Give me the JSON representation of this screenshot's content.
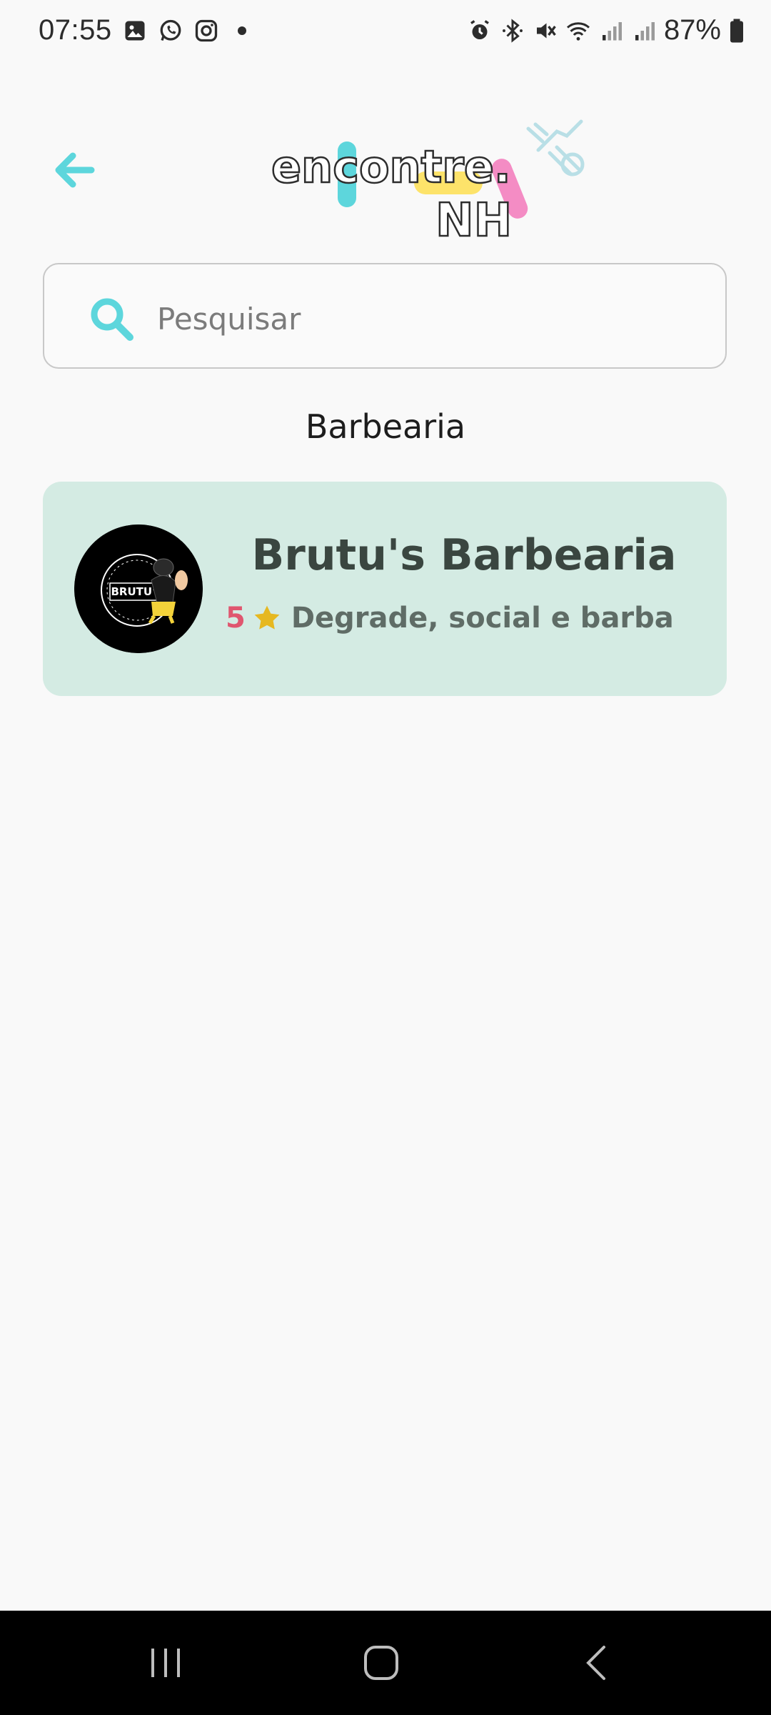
{
  "status_bar": {
    "time": "07:55",
    "battery": "87%",
    "left_icons": [
      "gallery-icon",
      "whatsapp-icon",
      "instagram-icon",
      "dot-icon"
    ],
    "right_icons": [
      "alarm-icon",
      "bluetooth-icon",
      "mute-icon",
      "wifi-icon",
      "signal-icon",
      "signal-icon",
      "battery-icon"
    ]
  },
  "header": {
    "logo_text_top": "encontre.",
    "logo_text_bottom": "NH",
    "logo_colors": {
      "cyan": "#5dd6dc",
      "yellow": "#fde36a",
      "pink": "#f48cc4",
      "outline": "#2d2d2d"
    }
  },
  "search": {
    "placeholder": "Pesquisar",
    "value": ""
  },
  "category": {
    "title": "Barbearia"
  },
  "results": [
    {
      "name": "Brutu's Barbearia",
      "rating": "5",
      "services": "Degrade, social e barba",
      "avatar_text": "BRUTU'S"
    }
  ],
  "colors": {
    "accent": "#5dd6dc",
    "card_bg": "#d4ebe3",
    "rating": "#e0566f",
    "star": "#e6b820",
    "background": "#f9f9f9"
  }
}
